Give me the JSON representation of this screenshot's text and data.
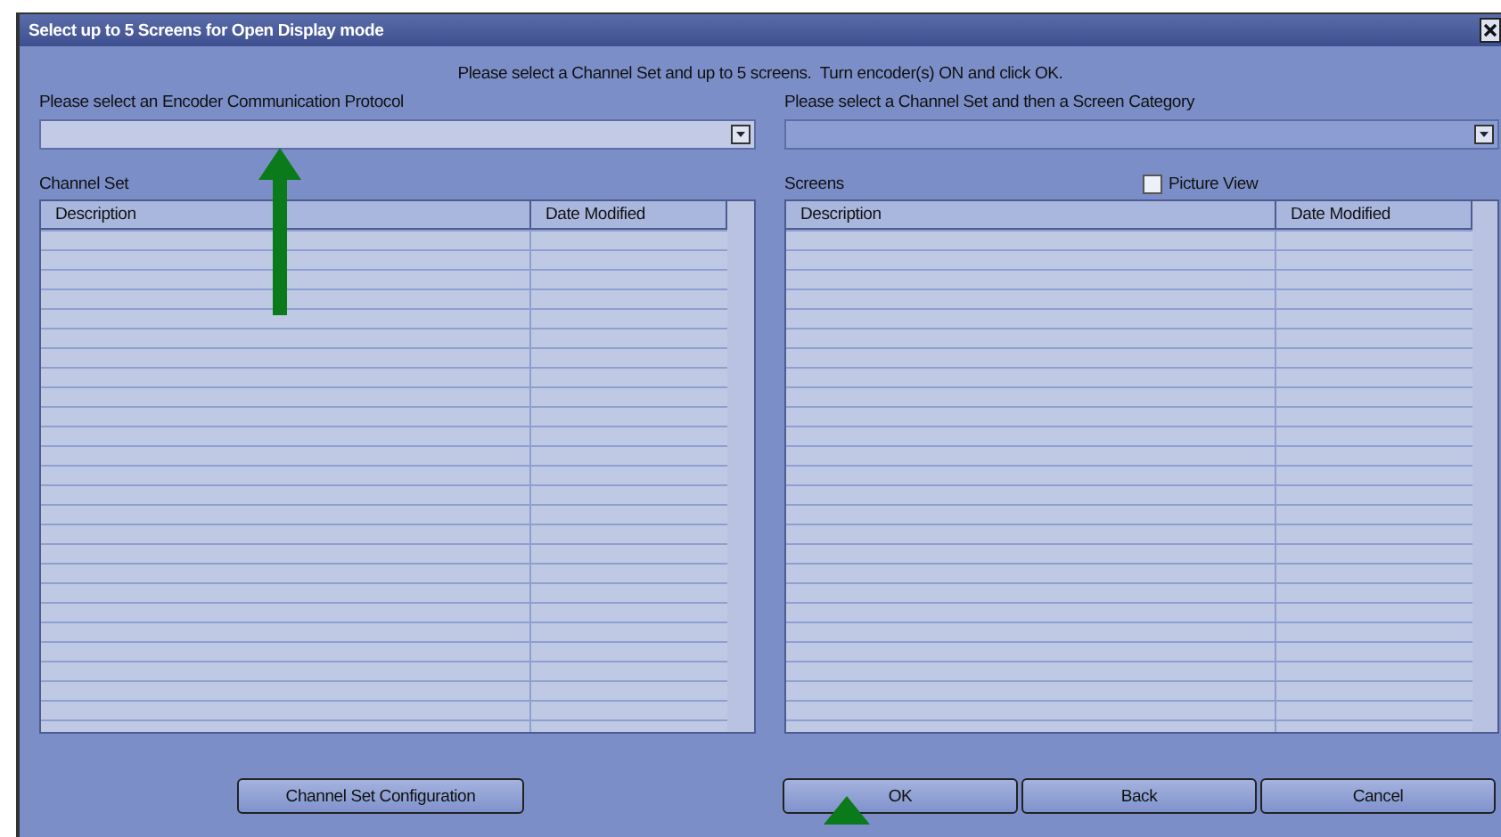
{
  "window": {
    "title": "Select up to 5 Screens for Open Display mode"
  },
  "instruction": "Please select a Channel Set and up to 5 screens.  Turn encoder(s) ON and click OK.",
  "left": {
    "combo_label": "Please select an Encoder Communication Protocol",
    "list_label": "Channel Set",
    "columns": [
      "Description",
      "Date Modified"
    ]
  },
  "right": {
    "combo_label": "Please select a Channel Set and then a Screen Category",
    "list_label": "Screens",
    "picture_view": {
      "label": "Picture View",
      "checked": false
    },
    "columns": [
      "Description",
      "Date Modified"
    ]
  },
  "buttons": {
    "left": [
      "Channel Set Configuration"
    ],
    "right": [
      "OK",
      "Back",
      "Cancel"
    ]
  }
}
